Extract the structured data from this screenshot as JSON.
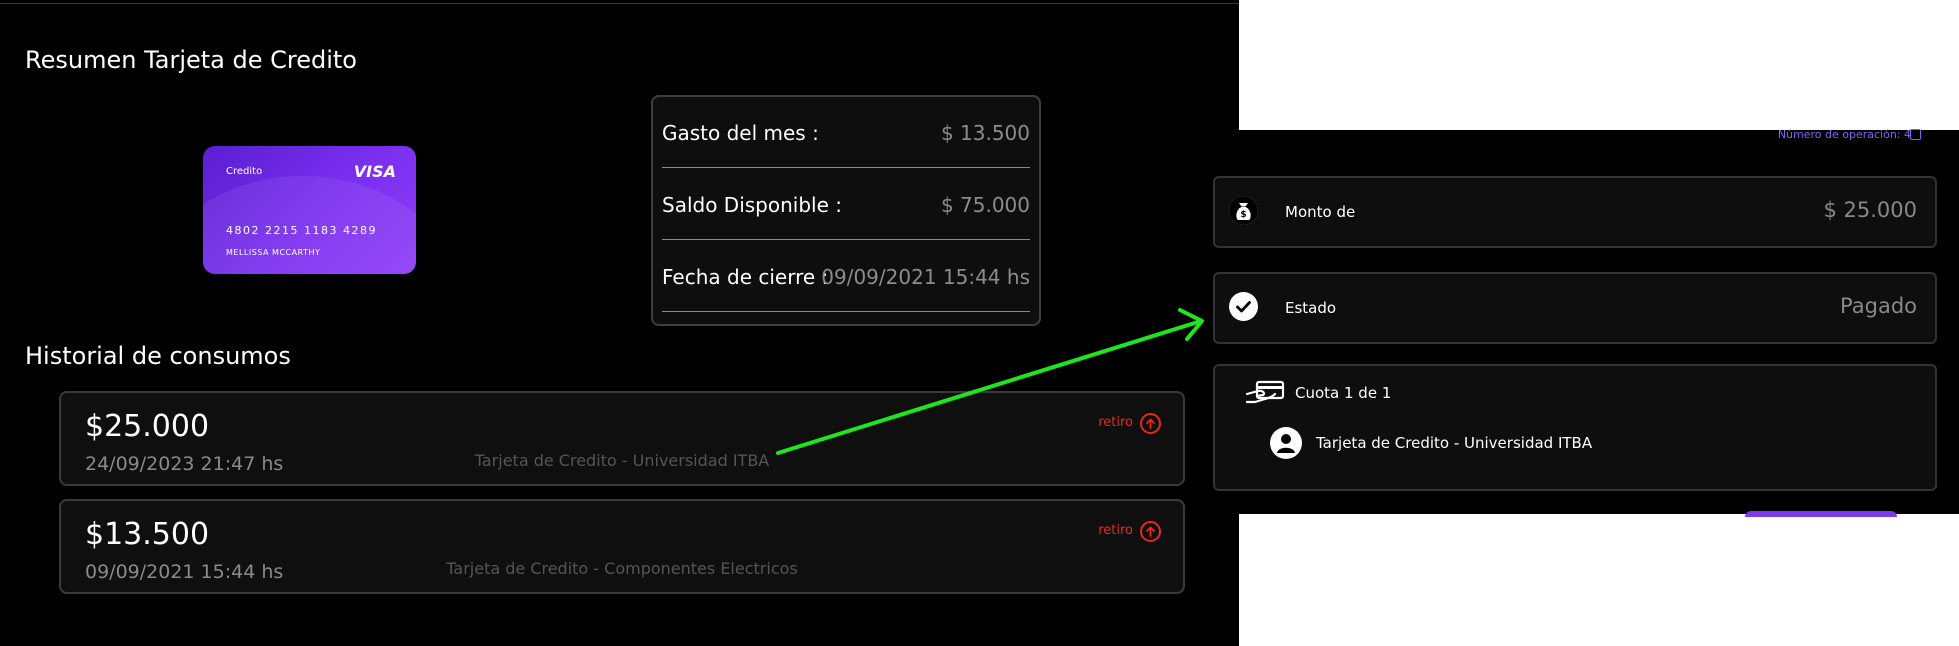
{
  "summary": {
    "title": "Resumen Tarjeta de Credito",
    "card": {
      "type_label": "Credito",
      "brand": "VISA",
      "number": "4802  2215  1183  4289",
      "holder": "MELLISSA MCCARTHY"
    },
    "rows": [
      {
        "label": "Gasto del mes :",
        "value": "$ 13.500"
      },
      {
        "label": "Saldo Disponible :",
        "value": "$ 75.000"
      },
      {
        "label": "Fecha de cierre :",
        "value": "09/09/2021 15:44 hs"
      }
    ]
  },
  "history": {
    "title": "Historial de consumos",
    "items": [
      {
        "amount": "$25.000",
        "date": "24/09/2023 21:47 hs",
        "description": "Tarjeta de Credito - Universidad ITBA",
        "type": "retiro"
      },
      {
        "amount": "$13.500",
        "date": "09/09/2021 15:44 hs",
        "description": "Tarjeta de Credito - Componentes Electricos",
        "type": "retiro"
      }
    ]
  },
  "detail": {
    "operation_number": "Número de operación: 4",
    "monto_label": "Monto de",
    "monto_value": "$ 25.000",
    "estado_label": "Estado",
    "estado_value": "Pagado",
    "cuota_label": "Cuota 1 de 1",
    "account_label": "Tarjeta de Credito - Universidad ITBA"
  },
  "icons": {
    "money_bag": "money-bag-icon",
    "check": "check-circle-icon",
    "card_hand": "card-hand-icon",
    "user": "user-icon",
    "arrow_up": "arrow-up-circle-icon",
    "copy": "copy-icon"
  },
  "colors": {
    "accent_purple": "#8b5cf6",
    "withdrawal_red": "#e8281e",
    "annotation_green": "#1ee61e"
  }
}
